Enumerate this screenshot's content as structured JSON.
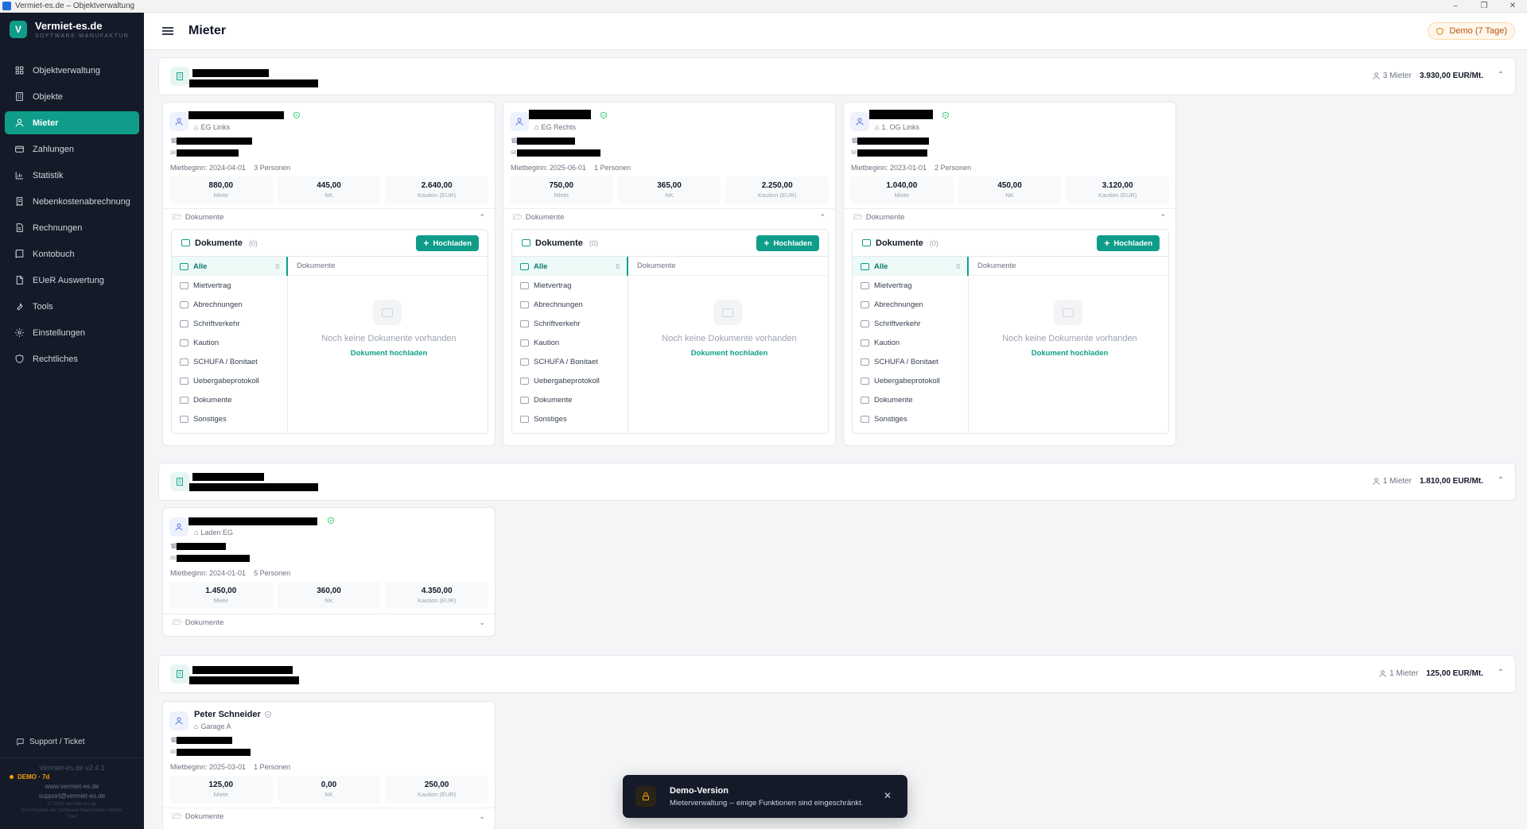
{
  "window": {
    "title": "Vermiet-es.de – Objektverwaltung"
  },
  "brand": {
    "name": "Vermiet-es.de",
    "tagline": "SOFTWARE-MANUFAKTUR",
    "logo_letter": "V"
  },
  "nav": [
    {
      "label": "Objektverwaltung",
      "icon": "grid-icon"
    },
    {
      "label": "Objekte",
      "icon": "building-icon"
    },
    {
      "label": "Mieter",
      "icon": "user-icon",
      "active": true
    },
    {
      "label": "Zahlungen",
      "icon": "card-icon"
    },
    {
      "label": "Statistik",
      "icon": "chart-icon"
    },
    {
      "label": "Nebenkostenabrechnung",
      "icon": "receipt-icon"
    },
    {
      "label": "Rechnungen",
      "icon": "document-icon"
    },
    {
      "label": "Kontobuch",
      "icon": "book-icon"
    },
    {
      "label": "EUeR Auswertung",
      "icon": "file-icon"
    },
    {
      "label": "Tools",
      "icon": "wrench-icon"
    },
    {
      "label": "Einstellungen",
      "icon": "gear-icon"
    },
    {
      "label": "Rechtliches",
      "icon": "shield-icon"
    }
  ],
  "support": {
    "label": "Support / Ticket"
  },
  "footer": {
    "version": "Vermiet-es.de v2.4.1",
    "demo": "DEMO · 7d",
    "website": "www.vermiet-es.de",
    "email": "support@vermiet-es.de",
    "copyright": "© 2024 vermiet-es.de",
    "product_line": "Ein Produkt der Software-Manufaktur Winter",
    "city": "Trier"
  },
  "header": {
    "title": "Mieter",
    "demo_badge": "Demo (7 Tage)"
  },
  "groups": [
    {
      "tenant_count": "3 Mieter",
      "rent_total": "3.930,00 EUR/Mt."
    },
    {
      "tenant_count": "1 Mieter",
      "rent_total": "1.810,00 EUR/Mt."
    },
    {
      "tenant_count": "1 Mieter",
      "rent_total": "125,00 EUR/Mt."
    }
  ],
  "tenants": [
    {
      "unit": "EG Links",
      "since": "Mietbeginn: 2024-04-01",
      "persons": "3 Personen",
      "miete": "880,00",
      "nk": "445,00",
      "kaution": "2.640,00"
    },
    {
      "unit": "EG Rechts",
      "since": "Mietbeginn: 2025-06-01",
      "persons": "1 Personen",
      "miete": "750,00",
      "nk": "365,00",
      "kaution": "2.250,00"
    },
    {
      "unit": "1. OG Links",
      "since": "Mietbeginn: 2023-01-01",
      "persons": "2 Personen",
      "miete": "1.040,00",
      "nk": "450,00",
      "kaution": "3.120,00"
    },
    {
      "unit": "Laden EG",
      "since": "Mietbeginn: 2024-01-01",
      "persons": "5 Personen",
      "miete": "1.450,00",
      "nk": "360,00",
      "kaution": "4.350,00"
    },
    {
      "name": "Peter Schneider",
      "unit": "Garage A",
      "since": "Mietbeginn: 2025-03-01",
      "persons": "1 Personen",
      "miete": "125,00",
      "nk": "0,00",
      "kaution": "250,00"
    }
  ],
  "labels": {
    "miete": "Miete",
    "nk": "NK",
    "kaution": "Kaution (EUR)",
    "dokumente": "Dokumente"
  },
  "docpanel": {
    "title": "Dokumente",
    "count": "(0)",
    "upload": "Hochladen",
    "list_header": "Dokumente",
    "empty": "Noch keine Dokumente vorhanden",
    "empty_link": "Dokument hochladen",
    "all_count": "0",
    "categories": [
      "Alle",
      "Mietvertrag",
      "Abrechnungen",
      "Schriftverkehr",
      "Kaution",
      "SCHUFA / Bonitaet",
      "Uebergabeprotokoll",
      "Dokumente",
      "Sonstiges"
    ]
  },
  "toast": {
    "title": "Demo-Version",
    "message": "Mieterverwaltung -- einige Funktionen sind eingeschränkt."
  },
  "colors": {
    "accent": "#0f9d8a",
    "sidebar": "#141a28",
    "warning": "#d97706"
  }
}
